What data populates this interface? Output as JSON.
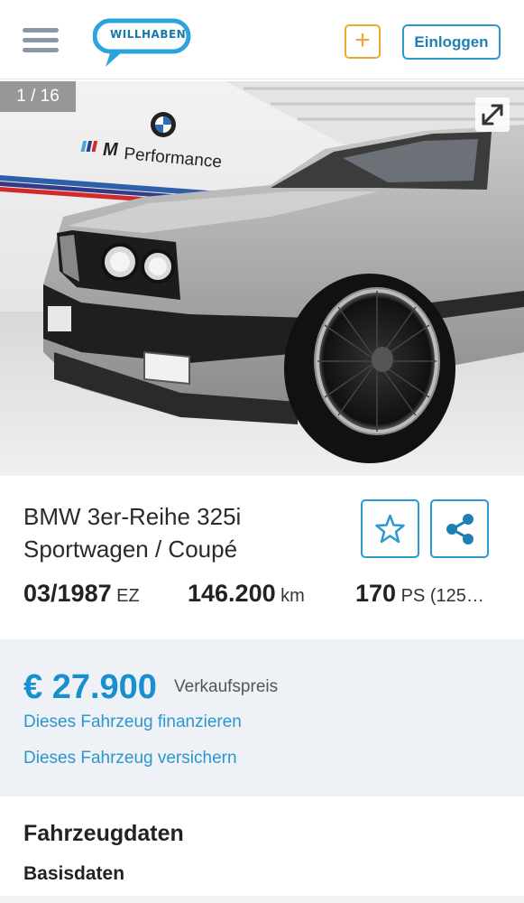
{
  "header": {
    "logo_text": "WILLHABEN",
    "add_label": "+",
    "login_label": "Einloggen",
    "colors": {
      "accent": "#2b9ad1",
      "add": "#f0a730"
    }
  },
  "gallery": {
    "counter": "1 / 16",
    "photo_brand_text": "Performance",
    "icons": [
      "expand-icon"
    ]
  },
  "listing": {
    "title_line1": "BMW 3er-Reihe 325i",
    "title_line2": "Sportwagen / Coupé",
    "specs": [
      {
        "value": "03/1987",
        "unit": "EZ"
      },
      {
        "value": "146.200",
        "unit": "km"
      },
      {
        "value": "170",
        "unit": "PS (125…"
      }
    ]
  },
  "price": {
    "amount": "€ 27.900",
    "label": "Verkaufspreis",
    "finance_link": "Dieses Fahrzeug finanzieren",
    "insure_link": "Dieses Fahrzeug versichern"
  },
  "sections": {
    "vehicle_data": "Fahrzeugdaten",
    "basic_data": "Basisdaten"
  }
}
